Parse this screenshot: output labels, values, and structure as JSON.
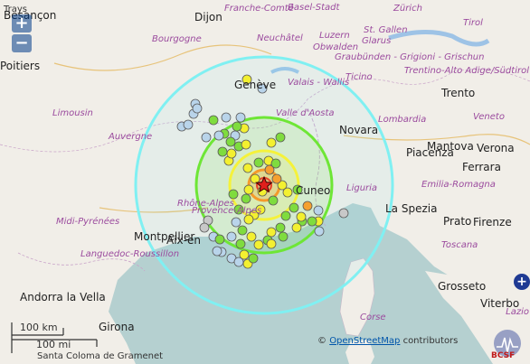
{
  "map": {
    "zoom_in_label": "+",
    "zoom_out_label": "−",
    "places": [
      {
        "name": "Dijon",
        "cls": "big"
      },
      {
        "name": "Franche-Comté",
        "cls": "region"
      },
      {
        "name": "Basel-Stadt",
        "cls": "region"
      },
      {
        "name": "Zürich",
        "cls": "region"
      },
      {
        "name": "Tirol",
        "cls": "region"
      },
      {
        "name": "Bourgogne",
        "cls": "region"
      },
      {
        "name": "Neuchâtel",
        "cls": "region"
      },
      {
        "name": "Luzern",
        "cls": "region"
      },
      {
        "name": "St. Gallen",
        "cls": "region"
      },
      {
        "name": "Obwalden",
        "cls": "region"
      },
      {
        "name": "Glarus",
        "cls": "region"
      },
      {
        "name": "Graubünden - Grigioni - Grischun",
        "cls": "region"
      },
      {
        "name": "Trentino-Alto Adige/Südtirol",
        "cls": "region"
      },
      {
        "name": "Valais - Wallis",
        "cls": "region"
      },
      {
        "name": "Ticino",
        "cls": "region"
      },
      {
        "name": "Genève",
        "cls": "big"
      },
      {
        "name": "Lombardia",
        "cls": "region"
      },
      {
        "name": "Trento",
        "cls": "big"
      },
      {
        "name": "Veneto",
        "cls": "region"
      },
      {
        "name": "Limousin",
        "cls": "region"
      },
      {
        "name": "Valle d'Aosta",
        "cls": "region"
      },
      {
        "name": "Verona",
        "cls": "big"
      },
      {
        "name": "Auvergne",
        "cls": "region"
      },
      {
        "name": "Novara",
        "cls": "big"
      },
      {
        "name": "Mantova",
        "cls": "big"
      },
      {
        "name": "Piacenza",
        "cls": "big"
      },
      {
        "name": "Ferrara",
        "cls": "big"
      },
      {
        "name": "Emilia-Romagna",
        "cls": "region"
      },
      {
        "name": "Cuneo",
        "cls": "big"
      },
      {
        "name": "Liguria",
        "cls": "region"
      },
      {
        "name": "La Spezia",
        "cls": "big"
      },
      {
        "name": "Midi-Pyrénées",
        "cls": "region"
      },
      {
        "name": "Provence-Alpes",
        "cls": "region"
      },
      {
        "name": "Prato",
        "cls": "big"
      },
      {
        "name": "Firenze",
        "cls": "big"
      },
      {
        "name": "Montpellier",
        "cls": "big"
      },
      {
        "name": "Languedoc-Roussillon",
        "cls": "region"
      },
      {
        "name": "Aix-en",
        "cls": "big"
      },
      {
        "name": "Toscana",
        "cls": "region"
      },
      {
        "name": "Grosseto",
        "cls": "big"
      },
      {
        "name": "Andorra la Vella",
        "cls": "big"
      },
      {
        "name": "Corse",
        "cls": "region"
      },
      {
        "name": "Viterbo",
        "cls": "big"
      },
      {
        "name": "Lazio",
        "cls": "region"
      },
      {
        "name": "Girona",
        "cls": "big"
      },
      {
        "name": "Santa Coloma de Gramenet",
        "cls": ""
      },
      {
        "name": "Poitiers",
        "cls": "big"
      },
      {
        "name": "Besançon",
        "cls": "big"
      },
      {
        "name": "Trays",
        "cls": ""
      },
      {
        "name": "Rhône-Alpes",
        "cls": "region"
      }
    ],
    "scale": {
      "km_label": "100 km",
      "mi_label": "100 mi"
    },
    "attribution": {
      "prefix": "©",
      "link": "OpenStreetMap",
      "suffix": " contributors"
    },
    "plus_label": "+",
    "logo_text": "BCSF"
  },
  "colors": {
    "sea": "#b5d0d0",
    "land": "#f1eee8",
    "ring_outer": "#80f0f2",
    "ring_green": "#6ee636",
    "ring_yellow": "#f5f23a",
    "ring_orange": "#f59a2a",
    "ring_red": "#e8442a",
    "epicenter": "#e0201c"
  }
}
